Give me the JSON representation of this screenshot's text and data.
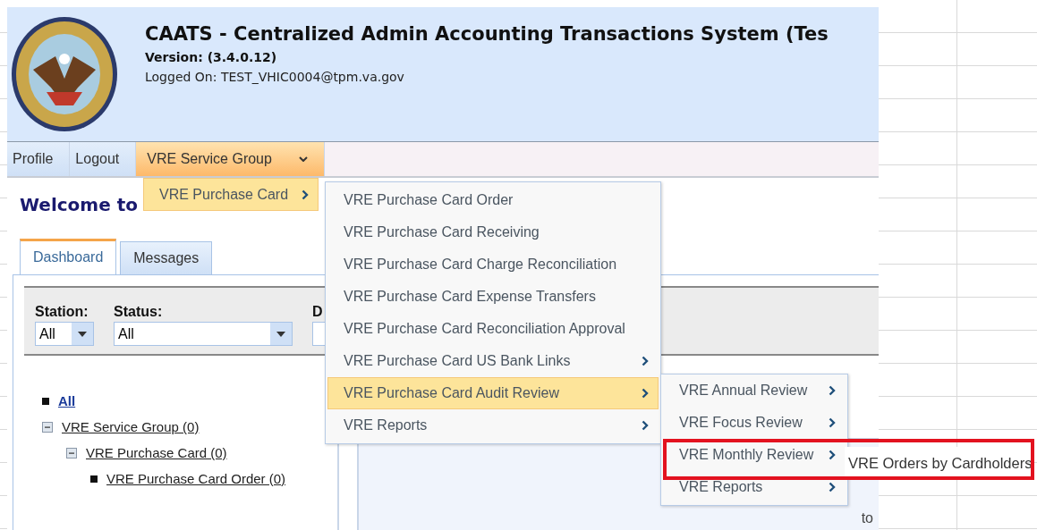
{
  "header": {
    "title": "CAATS - Centralized Admin Accounting Transactions System (Tes",
    "version": "Version: (3.4.0.12)",
    "logged_on": "Logged On: TEST_VHIC0004@tpm.va.gov"
  },
  "nav": [
    {
      "label": "Profile",
      "selected": false,
      "kind": "link"
    },
    {
      "label": "Logout",
      "selected": false,
      "kind": "link"
    },
    {
      "label": "VRE Service Group",
      "selected": true,
      "kind": "dropdown"
    }
  ],
  "menus": [
    {
      "items": [
        {
          "label": "VRE Purchase Card",
          "selected": true,
          "has_submenu": true
        }
      ]
    },
    {
      "items": [
        {
          "label": "VRE Purchase Card Order",
          "selected": false,
          "has_submenu": false
        },
        {
          "label": "VRE Purchase Card Receiving",
          "selected": false,
          "has_submenu": false
        },
        {
          "label": "VRE Purchase Card Charge Reconciliation",
          "selected": false,
          "has_submenu": false
        },
        {
          "label": "VRE Purchase Card Expense Transfers",
          "selected": false,
          "has_submenu": false
        },
        {
          "label": "VRE Purchase Card Reconciliation Approval",
          "selected": false,
          "has_submenu": false
        },
        {
          "label": "VRE Purchase Card US Bank Links",
          "selected": false,
          "has_submenu": true
        },
        {
          "label": "VRE Purchase Card Audit Review",
          "selected": true,
          "has_submenu": true
        },
        {
          "label": "VRE Reports",
          "selected": false,
          "has_submenu": true
        }
      ]
    },
    {
      "items": [
        {
          "label": "VRE Annual Review",
          "selected": false,
          "has_submenu": true
        },
        {
          "label": "VRE Focus Review",
          "selected": false,
          "has_submenu": true
        },
        {
          "label": "VRE Monthly Review",
          "selected": false,
          "has_submenu": true
        },
        {
          "label": "VRE Reports",
          "selected": false,
          "has_submenu": true
        }
      ]
    },
    {
      "items": [
        {
          "label": "VRE Orders by Cardholders",
          "selected": false,
          "has_submenu": false
        }
      ]
    }
  ],
  "highlight_box": true,
  "welcome": "Welcome to",
  "tabs": [
    {
      "label": "Dashboard",
      "selected": true
    },
    {
      "label": "Messages",
      "selected": false
    }
  ],
  "filters": [
    {
      "label": "Station:",
      "value": "All"
    },
    {
      "label": "Status:",
      "value": "All"
    },
    {
      "label": "D"
    }
  ],
  "tree": [
    {
      "label": "All",
      "bold": true
    },
    {
      "label": "VRE Service Group (0)",
      "expanded": true,
      "children": [
        {
          "label": "VRE Purchase Card (0)",
          "expanded": true,
          "children": [
            {
              "label": "VRE Purchase Card Order (0)"
            }
          ]
        }
      ]
    }
  ],
  "grid_note": "to"
}
